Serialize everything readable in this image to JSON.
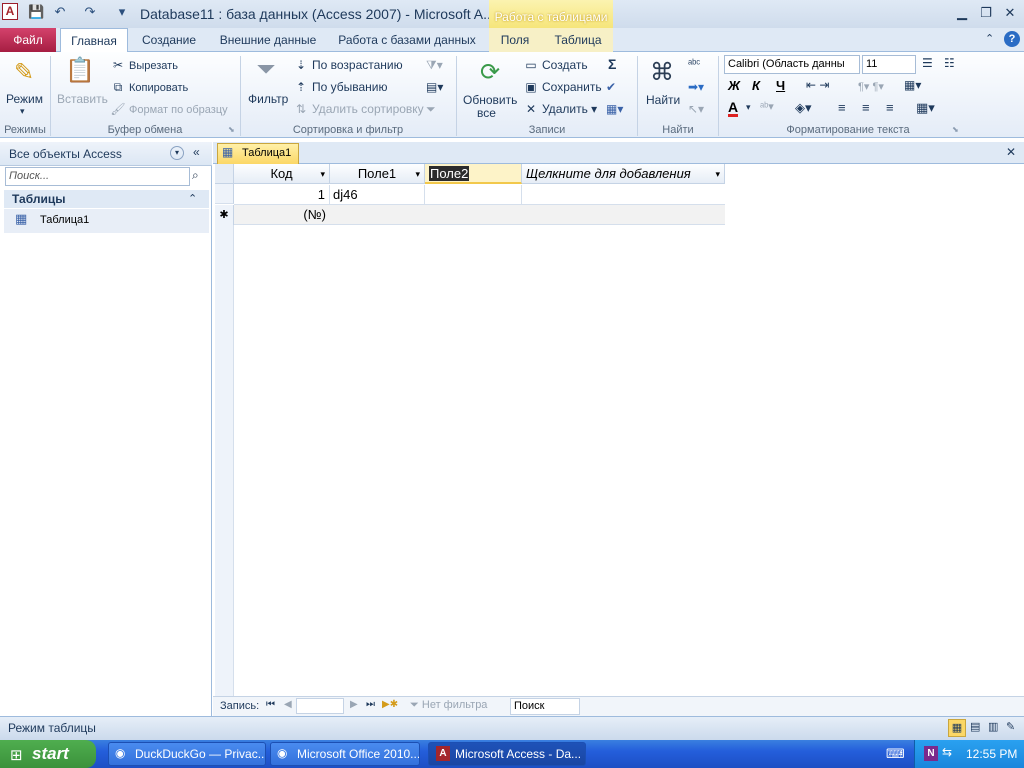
{
  "window": {
    "title": "Database11 : база данных (Access 2007)  -  Microsoft A...",
    "context_tab_header": "Работа с таблицами"
  },
  "tabs": {
    "file": "Файл",
    "home": "Главная",
    "create": "Создание",
    "external": "Внешние данные",
    "dbtools": "Работа с базами данных",
    "fields": "Поля",
    "table": "Таблица"
  },
  "ribbon": {
    "views": {
      "mode": "Режим",
      "label": "Режимы"
    },
    "clipboard": {
      "paste": "Вставить",
      "cut": "Вырезать",
      "copy": "Копировать",
      "format_painter": "Формат по образцу",
      "label": "Буфер обмена"
    },
    "sort": {
      "filter": "Фильтр",
      "asc": "По возрастанию",
      "desc": "По убыванию",
      "remove": "Удалить сортировку",
      "label": "Сортировка и фильтр"
    },
    "records": {
      "refresh1": "Обновить",
      "refresh2": "все",
      "new": "Создать",
      "save": "Сохранить",
      "delete": "Удалить",
      "totals": "Σ",
      "label": "Записи"
    },
    "find": {
      "find": "Найти",
      "label": "Найти"
    },
    "text": {
      "font": "Calibri (Область данны",
      "size": "11",
      "bold": "Ж",
      "italic": "К",
      "underline": "Ч",
      "label": "Форматирование текста"
    }
  },
  "nav": {
    "header": "Все объекты Access",
    "search_placeholder": "Поиск...",
    "section": "Таблицы",
    "item": "Таблица1"
  },
  "doc": {
    "tab": "Таблица1",
    "columns": [
      "Код",
      "Поле1",
      "Поле2",
      "Щелкните для добавления"
    ],
    "row1": {
      "id": "1",
      "field1": "dj46"
    },
    "new_row": {
      "marker": "✱",
      "id": "(№)"
    }
  },
  "recnav": {
    "label": "Запись:",
    "no_filter": "Нет фильтра",
    "search": "Поиск"
  },
  "status": {
    "mode": "Режим таблицы"
  },
  "taskbar": {
    "start": "start",
    "items": [
      "DuckDuckGo — Privac...",
      "Microsoft Office 2010...",
      "Microsoft Access - Da..."
    ],
    "time": "12:55 PM"
  },
  "colors": {
    "accent": "#2b579a",
    "file_tab": "#b62c50",
    "context": "#f6e57a"
  }
}
